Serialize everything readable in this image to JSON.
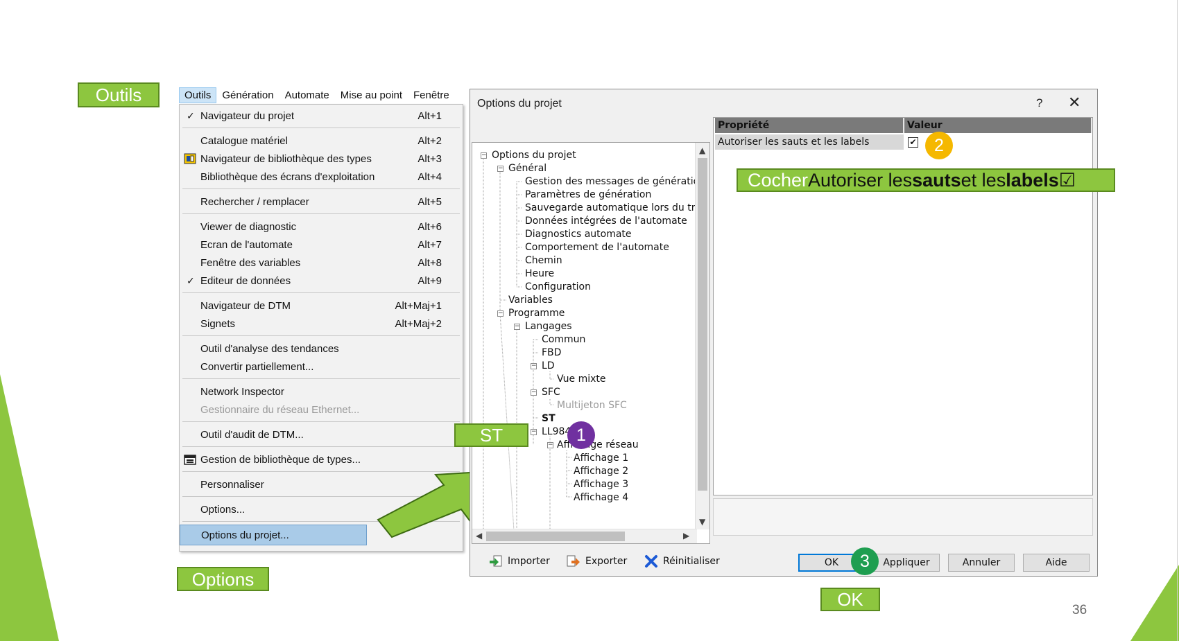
{
  "callouts": {
    "outils": "Outils",
    "options": "Options",
    "st": "ST",
    "ok": "OK",
    "instruction": {
      "p1": "Cocher",
      "p2": " Autoriser les ",
      "p3": "sauts",
      "p4": " et les ",
      "p5": "labels",
      "p6": " ☑"
    }
  },
  "badges": [
    "1",
    "2",
    "3"
  ],
  "colors": {
    "accent_green": "#8dc63f",
    "badge_purple": "#7030a0",
    "badge_orange": "#f5b800",
    "badge_green": "#1e9e50"
  },
  "menubar": [
    "Outils",
    "Génération",
    "Automate",
    "Mise au point",
    "Fenêtre"
  ],
  "menu": {
    "items": [
      {
        "label": "Navigateur du projet",
        "shortcut": "Alt+1",
        "checked": true
      },
      {
        "label": "Catalogue matériel",
        "shortcut": "Alt+2"
      },
      {
        "label": "Navigateur de bibliothèque des types",
        "shortcut": "Alt+3",
        "icon": "library-icon"
      },
      {
        "label": "Bibliothèque des écrans d'exploitation",
        "shortcut": "Alt+4"
      },
      {
        "label": "Rechercher / remplacer",
        "shortcut": "Alt+5"
      },
      {
        "label": "Viewer de diagnostic",
        "shortcut": "Alt+6"
      },
      {
        "label": "Ecran de l'automate",
        "shortcut": "Alt+7"
      },
      {
        "label": "Fenêtre des variables",
        "shortcut": "Alt+8"
      },
      {
        "label": "Editeur de données",
        "shortcut": "Alt+9",
        "checked": true
      },
      {
        "label": "Navigateur de DTM",
        "shortcut": "Alt+Maj+1"
      },
      {
        "label": "Signets",
        "shortcut": "Alt+Maj+2"
      },
      {
        "label": "Outil d'analyse des tendances",
        "shortcut": ""
      },
      {
        "label": "Convertir partiellement...",
        "shortcut": ""
      },
      {
        "label": "Network Inspector",
        "shortcut": ""
      },
      {
        "label": "Gestionnaire du réseau Ethernet...",
        "shortcut": "",
        "disabled": true
      },
      {
        "label": "Outil d'audit de DTM...",
        "shortcut": ""
      },
      {
        "label": "Gestion de bibliothèque de types...",
        "shortcut": "",
        "icon": "type-library-icon"
      },
      {
        "label": "Personnaliser",
        "shortcut": ""
      },
      {
        "label": "Options...",
        "shortcut": ""
      },
      {
        "label": "Options du projet...",
        "shortcut": "",
        "selected": true
      }
    ]
  },
  "dialog": {
    "title": "Options du projet",
    "help": "?",
    "close": "✕",
    "tree": [
      "Options du projet",
      "Général",
      "Gestion des messages de génération",
      "Paramètres de génération",
      "Sauvegarde automatique lors du transf",
      "Données intégrées de l'automate",
      "Diagnostics automate",
      "Comportement de l'automate",
      "Chemin",
      "Heure",
      "Configuration",
      "Variables",
      "Programme",
      "Langages",
      "Commun",
      "FBD",
      "LD",
      "Vue mixte",
      "SFC",
      "Multijeton SFC",
      "ST",
      "LL984",
      "Affichage réseau",
      "Affichage 1",
      "Affichage 2",
      "Affichage 3",
      "Affichage 4"
    ],
    "grid": {
      "col_property": "Propriété",
      "col_value": "Valeur",
      "row_property": "Autoriser les sauts et les labels",
      "row_checked": "✔"
    },
    "footer": {
      "import": "Importer",
      "export": "Exporter",
      "reset": "Réinitialiser",
      "ok": "OK",
      "apply": "Appliquer",
      "cancel": "Annuler",
      "help": "Aide"
    }
  },
  "page_number": "36"
}
